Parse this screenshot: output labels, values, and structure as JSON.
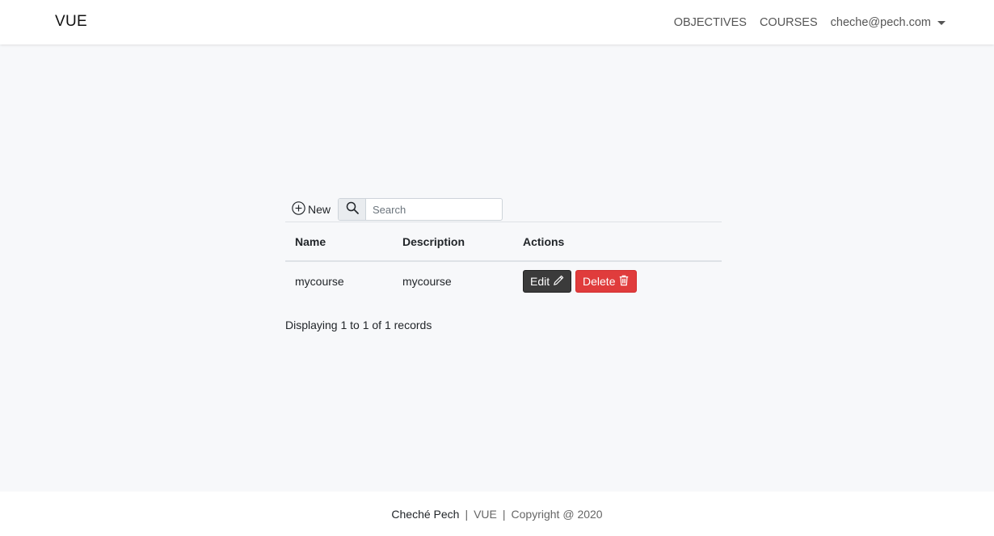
{
  "navbar": {
    "brand": "VUE",
    "links": [
      "OBJECTIVES",
      "COURSES"
    ],
    "user_email": "cheche@pech.com"
  },
  "toolbar": {
    "new_label": "New",
    "search_placeholder": "Search"
  },
  "table": {
    "headers": [
      "Name",
      "Description",
      "Actions"
    ],
    "rows": [
      {
        "name": "mycourse",
        "description": "mycourse"
      }
    ],
    "edit_label": "Edit",
    "delete_label": "Delete"
  },
  "records_text": "Displaying 1 to 1 of 1 records",
  "footer": {
    "author": "Cheché Pech",
    "separator": "|",
    "app": "VUE",
    "copyright": "Copyright @ 2020"
  },
  "icons": {
    "new": "plus-circle-icon",
    "search": "search-icon",
    "edit": "pencil-icon",
    "delete": "trash-icon",
    "user_menu": "caret-down-icon"
  },
  "colors": {
    "delete_button": "#e03c3c",
    "edit_button": "#3b3b3b",
    "page_background": "#f7f8fa"
  }
}
